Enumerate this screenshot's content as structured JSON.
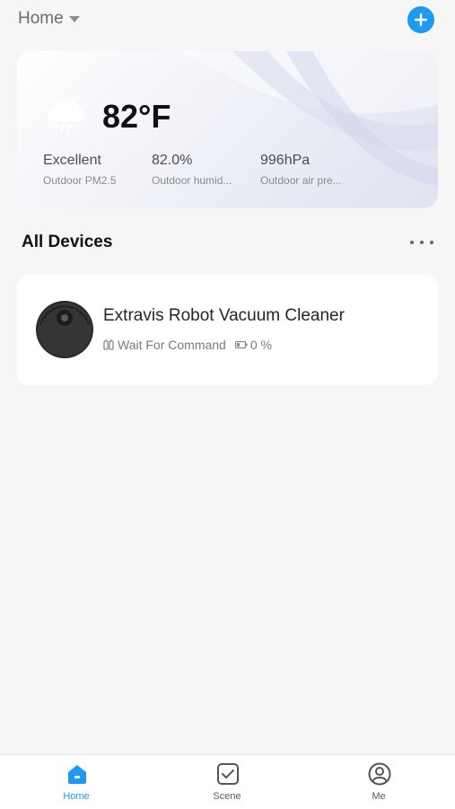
{
  "header": {
    "home_label": "Home"
  },
  "weather": {
    "temperature": "82°F",
    "stats": [
      {
        "value": "Excellent",
        "label": "Outdoor PM2.5"
      },
      {
        "value": "82.0%",
        "label": "Outdoor humid..."
      },
      {
        "value": "996hPa",
        "label": "Outdoor air pre..."
      }
    ]
  },
  "devices_section": {
    "title": "All Devices",
    "devices": [
      {
        "name": "Extravis Robot Vacuum Cleaner",
        "status": "Wait For Command",
        "battery": "0 %"
      }
    ]
  },
  "tabbar": {
    "tabs": [
      {
        "label": "Home",
        "icon": "home-icon",
        "active": true
      },
      {
        "label": "Scene",
        "icon": "scene-icon",
        "active": false
      },
      {
        "label": "Me",
        "icon": "profile-icon",
        "active": false
      }
    ]
  },
  "colors": {
    "accent": "#1d9bf0",
    "background": "#f6f6f7",
    "card": "#ffffff"
  }
}
